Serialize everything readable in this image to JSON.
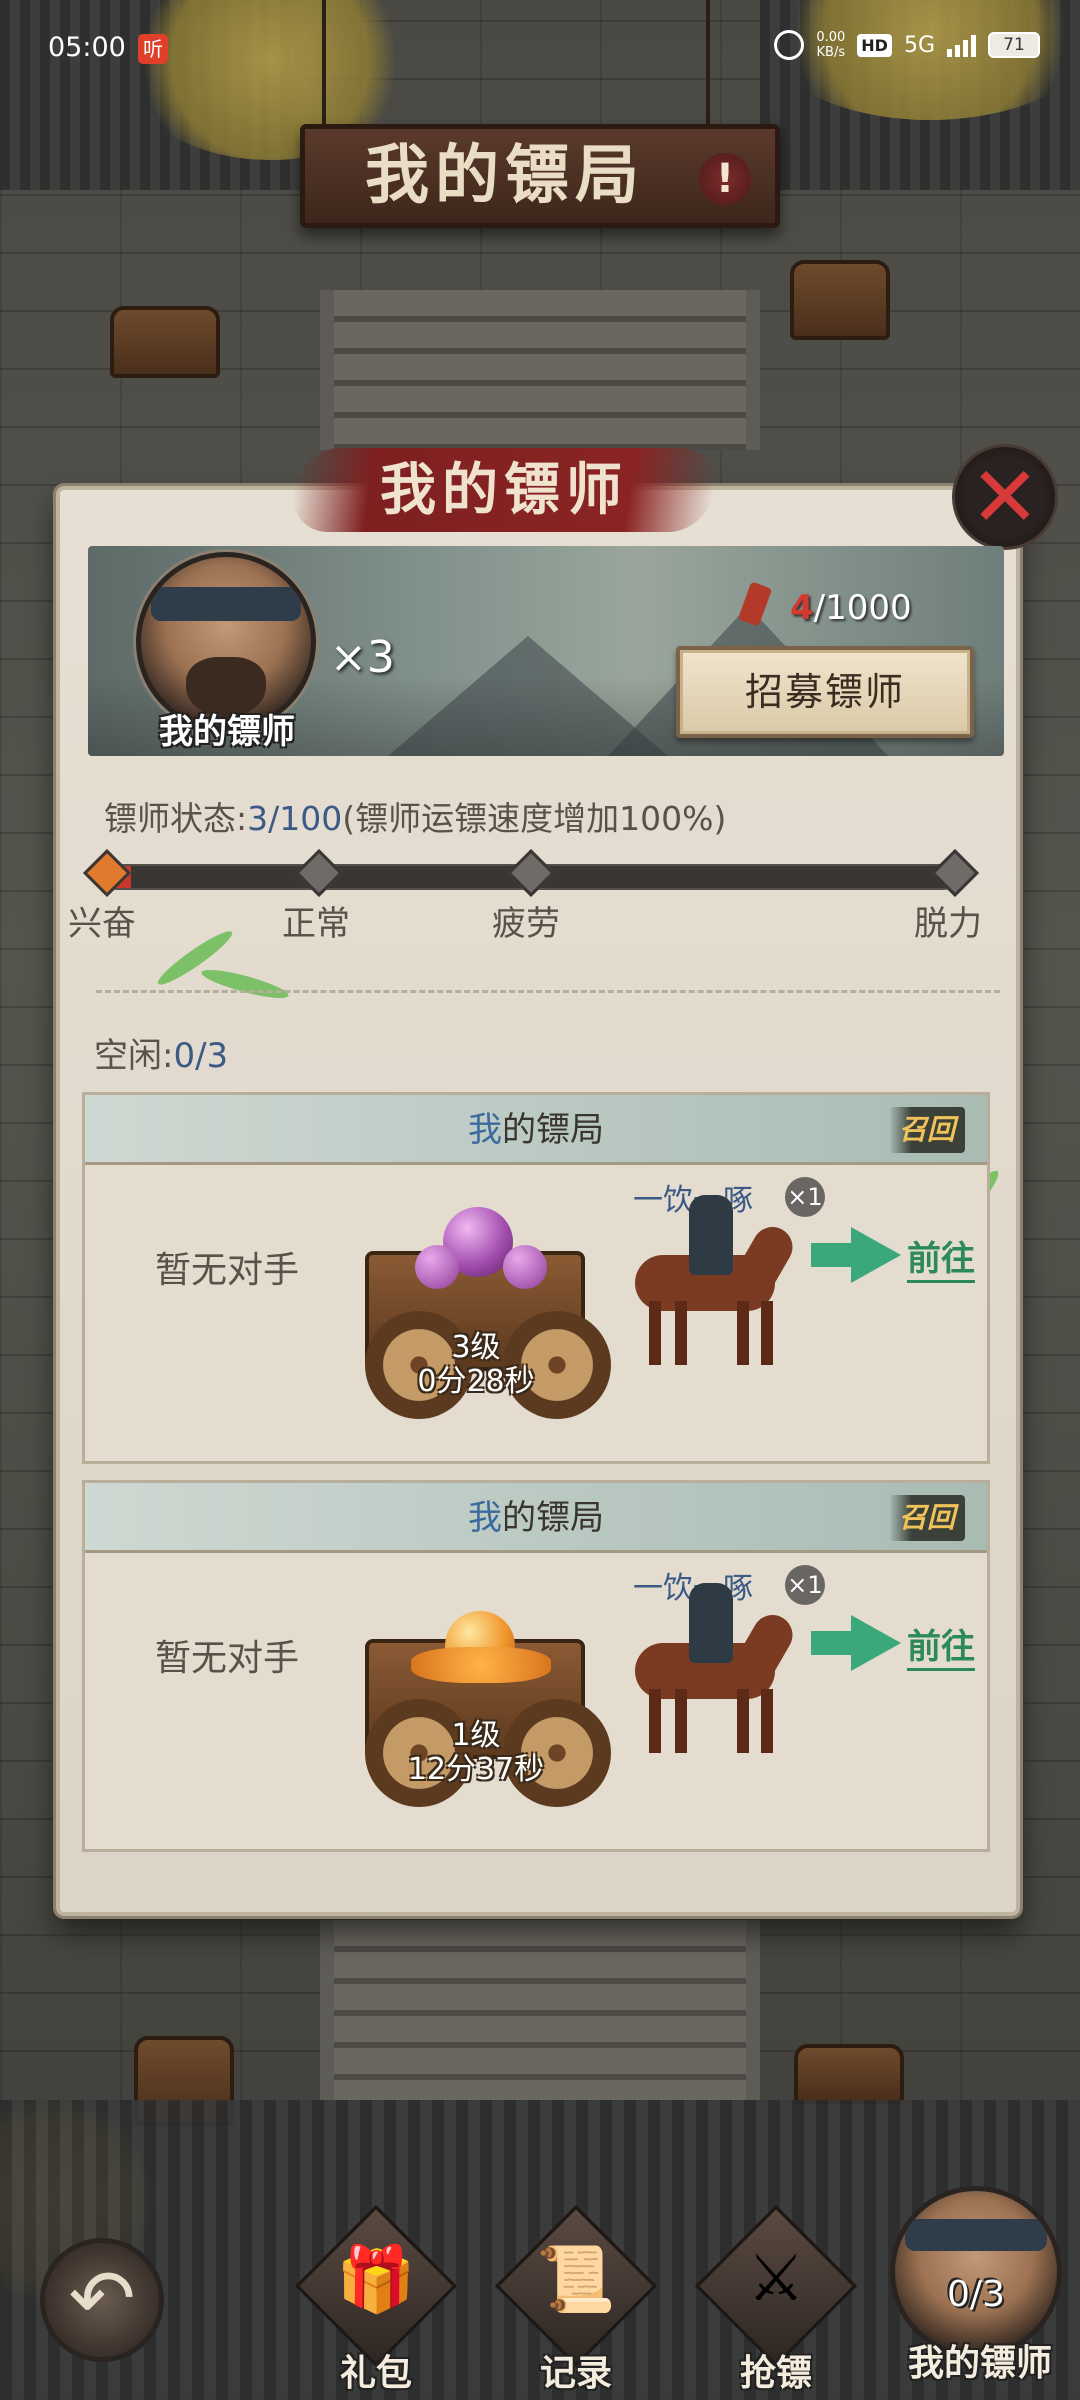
{
  "status_bar": {
    "time": "05:00",
    "app_badge": "听",
    "net_speed_value": "0.00",
    "net_speed_unit": "KB/s",
    "hd": "HD",
    "network": "5G",
    "battery": "71"
  },
  "top_sign": {
    "title": "我的镖局",
    "help": "!"
  },
  "panel": {
    "title": "我的镖师",
    "close": "✕",
    "portrait_label": "我的镖师",
    "portrait_count": "×3",
    "token_current": "4",
    "token_total": "/1000",
    "recruit_button": "招募镖师",
    "status_label": "镖师状态:",
    "status_value": "3/100",
    "status_note": "(镖师运镖速度增加100%)",
    "progress_fraction": 0.03,
    "stages": [
      "兴奋",
      "正常",
      "疲劳",
      "脱力"
    ],
    "idle_label": "空闲:",
    "idle_value": "0/3"
  },
  "escorts": [
    {
      "title_highlight": "我",
      "title_rest": "的镖局",
      "recall": "召回",
      "opponent": "暂无对手",
      "rider": "一饮一啄",
      "multiplier": "×1",
      "level": "3级",
      "timer": "0分28秒",
      "go": "前往",
      "cargo_color": "#a34fb0"
    },
    {
      "title_highlight": "我",
      "title_rest": "的镖局",
      "recall": "召回",
      "opponent": "暂无对手",
      "rider": "一饮一啄",
      "multiplier": "×1",
      "level": "1级",
      "timer": "12分37秒",
      "go": "前往",
      "cargo_color": "#f0952a"
    }
  ],
  "bottom_nav": {
    "back_icon": "back-arrow-icon",
    "items": [
      {
        "label": "礼包",
        "icon": "gift-box-icon"
      },
      {
        "label": "记录",
        "icon": "scroll-record-icon"
      },
      {
        "label": "抢镖",
        "icon": "crossed-weapons-icon"
      }
    ],
    "hero_count": "0/3",
    "hero_label": "我的镖师"
  }
}
